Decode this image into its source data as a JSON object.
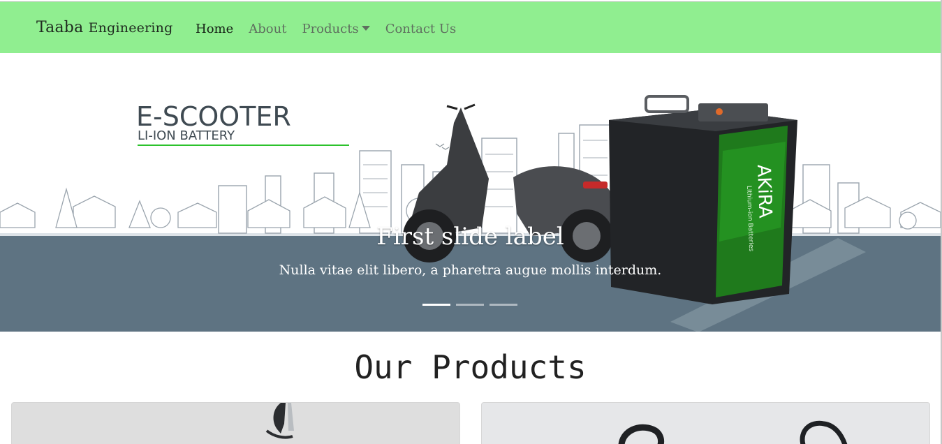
{
  "navbar": {
    "brand_main": "Taaba",
    "brand_sub": "Engineering",
    "links": [
      {
        "label": "Home",
        "active": true
      },
      {
        "label": "About"
      },
      {
        "label": "Products",
        "dropdown": true
      },
      {
        "label": "Contact Us"
      }
    ],
    "bg_color": "#90ee90"
  },
  "carousel": {
    "banner_heading": "E-SCOOTER",
    "banner_subheading": "LI-ION BATTERY",
    "battery_brand": "AKiRA",
    "battery_tagline": "Lithium-ion Batteries",
    "caption_title": "First slide label",
    "caption_text": "Nulla vitae elit libero, a pharetra augue mollis interdum.",
    "slides_count": 3,
    "active_index": 0
  },
  "products": {
    "title": "Our Products",
    "cards": [
      {
        "icon": "product-image-1"
      },
      {
        "icon": "product-image-2"
      }
    ]
  }
}
